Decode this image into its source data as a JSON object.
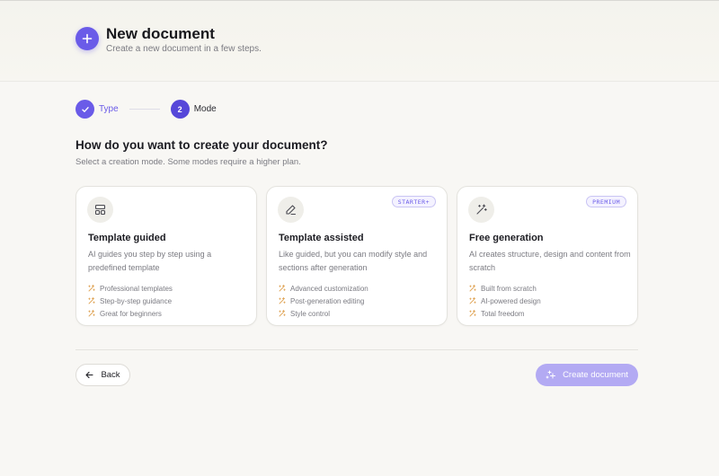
{
  "header": {
    "title": "New document",
    "subtitle": "Create a new document in a few steps.",
    "icon": "plus-icon"
  },
  "stepper": {
    "steps": [
      {
        "number": "",
        "label": "Type",
        "state": "done"
      },
      {
        "number": "2",
        "label": "Mode",
        "state": "current"
      }
    ]
  },
  "main": {
    "question": "How do you want to create your document?",
    "subtext": "Select a creation mode. Some modes require a higher plan."
  },
  "cards": [
    {
      "icon": "layout-template-icon",
      "badge": "",
      "title": "Template guided",
      "description": "AI guides you step by step using a predefined template",
      "features": [
        "Professional templates",
        "Step-by-step guidance",
        "Great for beginners"
      ]
    },
    {
      "icon": "pencil-icon",
      "badge": "STARTER+",
      "title": "Template assisted",
      "description": "Like guided, but you can modify style and sections after generation",
      "features": [
        "Advanced customization",
        "Post-generation editing",
        "Style control"
      ]
    },
    {
      "icon": "magic-wand-icon",
      "badge": "PREMIUM",
      "title": "Free generation",
      "description": "AI creates structure, design and content from scratch",
      "features": [
        "Built from scratch",
        "AI-powered design",
        "Total freedom"
      ]
    }
  ],
  "footer": {
    "back_label": "Back",
    "create_label": "Create document"
  },
  "colors": {
    "accent": "#6a5be8",
    "feature_sparkle": "#e0a65a",
    "create_disabled": "#b3aaf3",
    "background": "#f8f7f4"
  }
}
